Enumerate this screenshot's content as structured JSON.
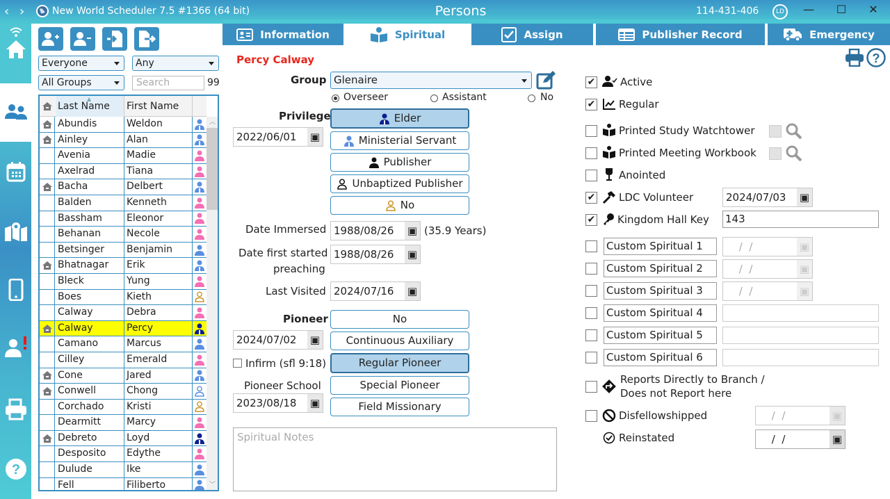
{
  "titlebar": {
    "app_title": "New World Scheduler 7.5 #1366 (64 bit)",
    "window_title": "Persons",
    "code": "114-431-406",
    "user_initials": "LD",
    "minimize": "—",
    "maximize": "☐",
    "close": "✕"
  },
  "leftnav": {
    "items": [
      {
        "name": "home",
        "icon": "home-icon"
      },
      {
        "name": "persons",
        "icon": "people-icon",
        "active": true
      },
      {
        "name": "calendar",
        "icon": "calendar-icon"
      },
      {
        "name": "territory-map",
        "icon": "map-icon"
      },
      {
        "name": "mobile",
        "icon": "phone-icon"
      },
      {
        "name": "person-alert",
        "icon": "person-alert-icon"
      },
      {
        "name": "print",
        "icon": "printer-icon"
      },
      {
        "name": "help",
        "icon": "help-icon"
      }
    ]
  },
  "filters": {
    "status": "Everyone",
    "type": "Any",
    "group": "All Groups",
    "search_placeholder": "Search",
    "count": "99"
  },
  "grid": {
    "columns": [
      "Last Name",
      "First Name"
    ],
    "rows": [
      {
        "last": "Abundis",
        "first": "Weldon",
        "home": true,
        "kind": "ms"
      },
      {
        "last": "Ainley",
        "first": "Alan",
        "home": true,
        "kind": "ms"
      },
      {
        "last": "Avenia",
        "first": "Madie",
        "home": false,
        "kind": "female"
      },
      {
        "last": "Axelrad",
        "first": "Tiana",
        "home": false,
        "kind": "female"
      },
      {
        "last": "Bacha",
        "first": "Delbert",
        "home": true,
        "kind": "ms"
      },
      {
        "last": "Balden",
        "first": "Kenneth",
        "home": false,
        "kind": "female"
      },
      {
        "last": "Bassham",
        "first": "Eleonor",
        "home": false,
        "kind": "female"
      },
      {
        "last": "Behanan",
        "first": "Necole",
        "home": false,
        "kind": "female"
      },
      {
        "last": "Betsinger",
        "first": "Benjamin",
        "home": false,
        "kind": "male"
      },
      {
        "last": "Bhatnagar",
        "first": "Erik",
        "home": true,
        "kind": "ms"
      },
      {
        "last": "Bleck",
        "first": "Yung",
        "home": false,
        "kind": "female"
      },
      {
        "last": "Boes",
        "first": "Kieth",
        "home": false,
        "kind": "no"
      },
      {
        "last": "Calway",
        "first": "Debra",
        "home": false,
        "kind": "female"
      },
      {
        "last": "Calway",
        "first": "Percy",
        "home": true,
        "kind": "elder",
        "selected": true
      },
      {
        "last": "Camano",
        "first": "Marcus",
        "home": false,
        "kind": "male"
      },
      {
        "last": "Cilley",
        "first": "Emerald",
        "home": false,
        "kind": "female"
      },
      {
        "last": "Cone",
        "first": "Jared",
        "home": true,
        "kind": "ms"
      },
      {
        "last": "Conwell",
        "first": "Chong",
        "home": true,
        "kind": "unbaptized"
      },
      {
        "last": "Corchado",
        "first": "Kristi",
        "home": false,
        "kind": "no"
      },
      {
        "last": "Dearmitt",
        "first": "Marcy",
        "home": false,
        "kind": "female"
      },
      {
        "last": "Debreto",
        "first": "Loyd",
        "home": true,
        "kind": "elder"
      },
      {
        "last": "Desposito",
        "first": "Edythe",
        "home": false,
        "kind": "female"
      },
      {
        "last": "Dulude",
        "first": "Ike",
        "home": false,
        "kind": "male"
      },
      {
        "last": "Fell",
        "first": "Filiberto",
        "home": false,
        "kind": "male"
      }
    ]
  },
  "tabs": [
    {
      "label": "Information",
      "icon": "id-card-icon"
    },
    {
      "label": "Spiritual",
      "icon": "reader-icon",
      "active": true
    },
    {
      "label": "Assign",
      "icon": "checkbox-icon"
    },
    {
      "label": "Publisher Record",
      "icon": "table-icon"
    },
    {
      "label": "Emergency",
      "icon": "ambulance-icon"
    }
  ],
  "person": {
    "name": "Percy Calway",
    "name_color": "#e8261c"
  },
  "group": {
    "label": "Group",
    "value": "Glenaire",
    "roles": [
      "Overseer",
      "Assistant",
      "No"
    ],
    "selected_role": "Overseer"
  },
  "privilege": {
    "label": "Privilege",
    "date": "2022/06/01",
    "options": [
      "Elder",
      "Ministerial Servant",
      "Publisher",
      "Unbaptized Publisher",
      "No"
    ],
    "selected": "Elder"
  },
  "dates": {
    "immersed_label": "Date Immersed",
    "immersed": "1988/08/26",
    "immersed_years": "(35.9 Years)",
    "started_label_1": "Date first started",
    "started_label_2": "preaching",
    "started": "1988/08/26",
    "visited_label": "Last Visited",
    "visited": "2024/07/16"
  },
  "pioneer": {
    "label": "Pioneer",
    "date": "2024/07/02",
    "infirm_label": "Infirm (sfl 9:18)",
    "infirm": false,
    "school_label": "Pioneer School",
    "school_date": "2023/08/18",
    "options": [
      "No",
      "Continuous Auxiliary",
      "Regular Pioneer",
      "Special Pioneer",
      "Field Missionary"
    ],
    "selected": "Regular Pioneer"
  },
  "notes": {
    "placeholder": "Spiritual Notes"
  },
  "right": {
    "active": {
      "label": "Active",
      "checked": true
    },
    "regular": {
      "label": "Regular",
      "checked": true
    },
    "printed_watchtower": {
      "label": "Printed Study Watchtower",
      "checked": false
    },
    "printed_workbook": {
      "label": "Printed Meeting Workbook",
      "checked": false
    },
    "anointed": {
      "label": "Anointed",
      "checked": false
    },
    "ldc": {
      "label": "LDC Volunteer",
      "checked": true,
      "date": "2024/07/03"
    },
    "key": {
      "label": "Kingdom Hall Key",
      "checked": true,
      "value": "143"
    },
    "custom": [
      {
        "label": "Custom Spiritual 1",
        "value": " /  /"
      },
      {
        "label": "Custom Spiritual 2",
        "value": " /  /"
      },
      {
        "label": "Custom Spiritual 3",
        "value": " /  /"
      },
      {
        "label": "Custom Spiritual 4",
        "value": ""
      },
      {
        "label": "Custom Spiritual 5",
        "value": ""
      },
      {
        "label": "Custom Spiritual 6",
        "value": ""
      }
    ],
    "reports_branch_1": "Reports Directly to Branch /",
    "reports_branch_2": "Does not Report here",
    "disfellowshipped": {
      "label": "Disfellowshipped",
      "date": " /  /"
    },
    "reinstated": {
      "label": "Reinstated",
      "date": " /  /"
    }
  },
  "colors": {
    "accent": "#3a8fc2",
    "titlebar_top": "#3a95c8",
    "titlebar_bottom": "#4cc7d4",
    "selected_row": "#ffff00",
    "selected_button": "#b0d2ea",
    "elder": "#0a1f8f",
    "ms": "#5a8fe0",
    "female": "#f46fb4",
    "no": "#c8962a"
  }
}
